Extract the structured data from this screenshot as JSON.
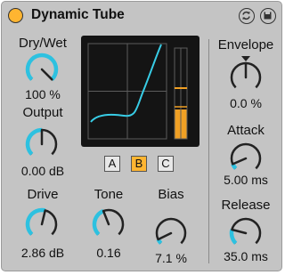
{
  "device": {
    "title": "Dynamic Tube",
    "accent_color": "#ffb531",
    "knob_arc_color": "#2dc1e0",
    "curve_color": "#38cde6"
  },
  "controls": {
    "drywet": {
      "label": "Dry/Wet",
      "value": "100 %",
      "level": 1.0
    },
    "output": {
      "label": "Output",
      "value": "0.00 dB",
      "level": 0.5
    },
    "drive": {
      "label": "Drive",
      "value": "2.86 dB",
      "level": 0.55
    },
    "tone": {
      "label": "Tone",
      "value": "0.16",
      "level": 0.42
    },
    "bias": {
      "label": "Bias",
      "value": "7.1 %",
      "level": 0.07
    },
    "envelope": {
      "label": "Envelope",
      "value": "0.0 %",
      "level": 0.5
    },
    "attack": {
      "label": "Attack",
      "value": "5.00 ms",
      "level": 0.08
    },
    "release": {
      "label": "Release",
      "value": "35.0 ms",
      "level": 0.22
    }
  },
  "tube_select": {
    "options": [
      "A",
      "B",
      "C"
    ],
    "selected": "B"
  }
}
